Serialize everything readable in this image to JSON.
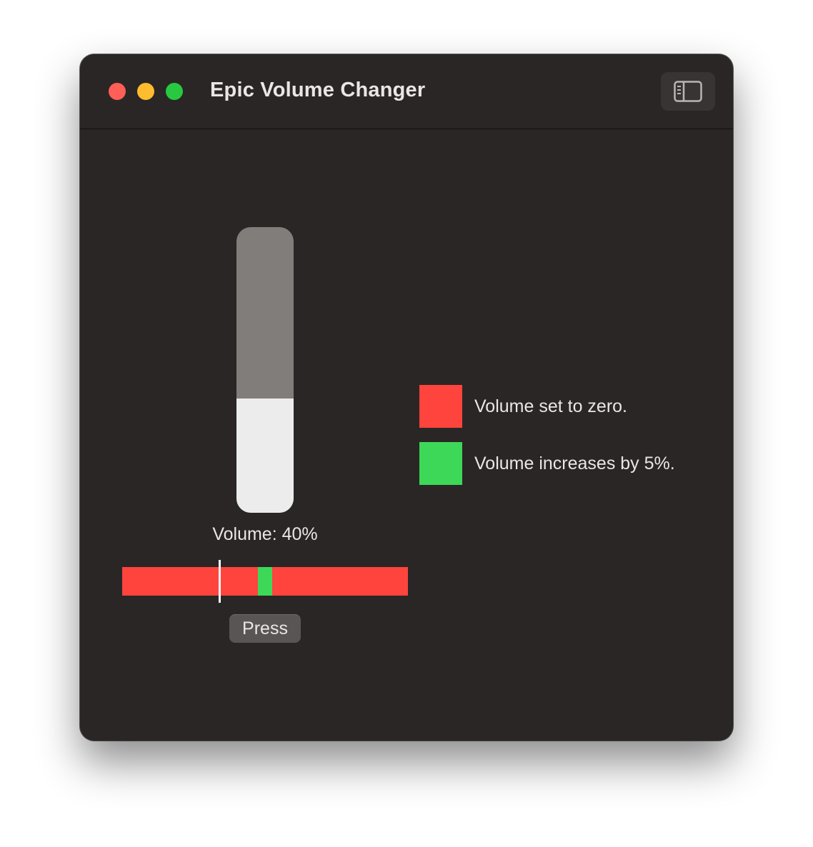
{
  "window": {
    "title": "Epic Volume Changer",
    "traffic_lights": {
      "close_color": "#ff5f57",
      "minimize_color": "#febc2e",
      "maximize_color": "#28c840"
    },
    "toolbar": {
      "sidebar_toggle_icon": "sidebar-left-icon"
    }
  },
  "volume": {
    "level_percent": 40,
    "label": "Volume: 40%",
    "track_color": "#807d7a",
    "fill_color": "#ececec"
  },
  "timing_bar": {
    "base_color": "#ff443e",
    "target_color": "#3ed858",
    "target_start_fraction": 0.475,
    "target_width_fraction": 0.05,
    "marker_fraction": 0.34,
    "marker_color": "#ffffff"
  },
  "actions": {
    "press_label": "Press"
  },
  "legend": [
    {
      "color": "#ff443e",
      "text": "Volume set to zero."
    },
    {
      "color": "#3ed858",
      "text": "Volume increases by 5%."
    }
  ]
}
